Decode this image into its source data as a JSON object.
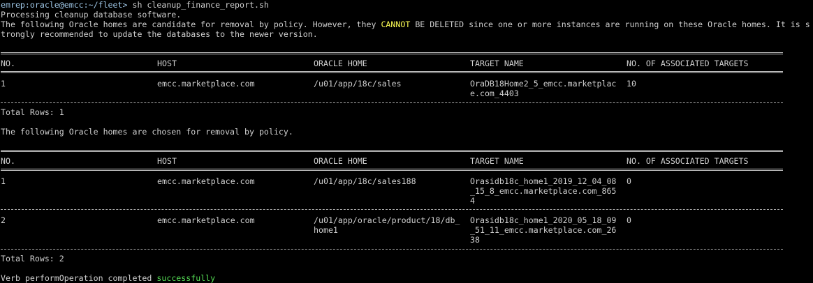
{
  "prompt": {
    "user_host_path": "emrep:oracle@emcc:~/fleet>",
    "command": " sh cleanup_finance_report.sh"
  },
  "intro": {
    "line1": "Processing cleanup database software.",
    "line2_pre": "The following Oracle homes are candidate for removal by policy. However, they ",
    "line2_em": "CANNOT",
    "line2_post": " BE DELETED since one or more instances are running on these Oracle homes. It is s",
    "line3": "trongly recommended to update the databases to the newer version."
  },
  "headers": [
    "NO.",
    "HOST",
    "ORACLE HOME",
    "TARGET NAME",
    "NO. OF ASSOCIATED TARGETS"
  ],
  "table1": {
    "rows": [
      {
        "no": "1",
        "host": "emcc.marketplace.com",
        "home": [
          "/u01/app/18c/sales"
        ],
        "target": [
          "OraDB18Home2_5_emcc.marketplac",
          "e.com_4403"
        ],
        "assoc": "10"
      }
    ],
    "total": "Total Rows: 1"
  },
  "middle_text": "The following Oracle homes are chosen for removal by policy.",
  "table2": {
    "rows": [
      {
        "no": "1",
        "host": "emcc.marketplace.com",
        "home": [
          "/u01/app/18c/sales188"
        ],
        "target": [
          "Orasidb18c_home1_2019_12_04_08",
          "_15_8_emcc.marketplace.com_865",
          "4"
        ],
        "assoc": "0"
      },
      {
        "no": "2",
        "host": "emcc.marketplace.com",
        "home": [
          "/u01/app/oracle/product/18/db_",
          "home1"
        ],
        "target": [
          "Orasidb18c_home1_2020_05_18_09",
          "_51_11_emcc.marketplace.com_26",
          "38"
        ],
        "assoc": "0"
      }
    ],
    "total": "Total Rows: 2"
  },
  "footer": {
    "pre": "Verb performOperation completed ",
    "status": "successfully"
  },
  "colors": {
    "background": "#000000",
    "text": "#d0d0d0",
    "warning": "#ffff55",
    "success": "#55dd55"
  }
}
